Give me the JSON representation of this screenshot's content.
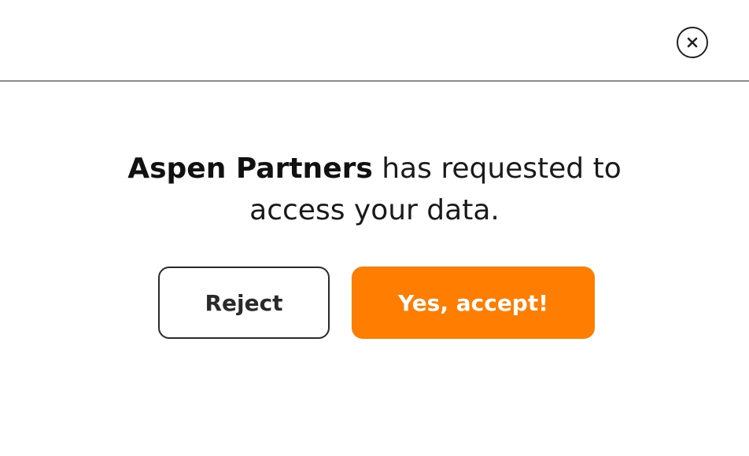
{
  "dialog": {
    "close_icon": "close-icon",
    "message": {
      "organization": "Aspen Partners",
      "line1_rest": " has requested to",
      "line2": "access your data."
    },
    "buttons": {
      "reject_label": "Reject",
      "accept_label": "Yes, accept!"
    }
  },
  "colors": {
    "accent": "#ff7d00",
    "text": "#1a1a1a",
    "divider": "#8a8a8a",
    "background": "#ffffff"
  }
}
